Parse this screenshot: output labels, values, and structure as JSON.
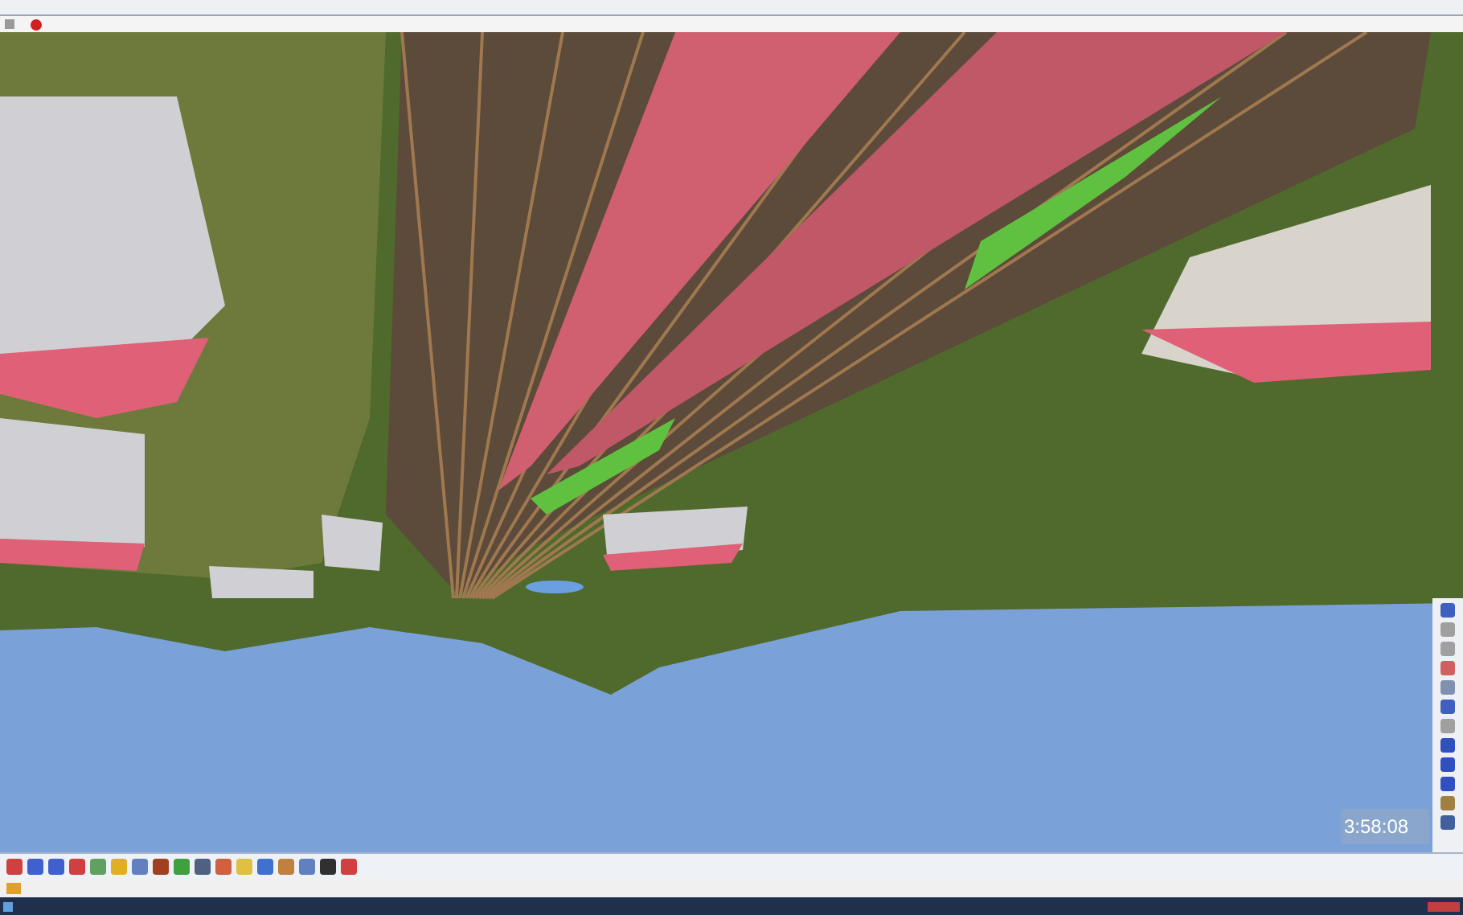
{
  "clock": {
    "time": "3:58:08"
  }
}
